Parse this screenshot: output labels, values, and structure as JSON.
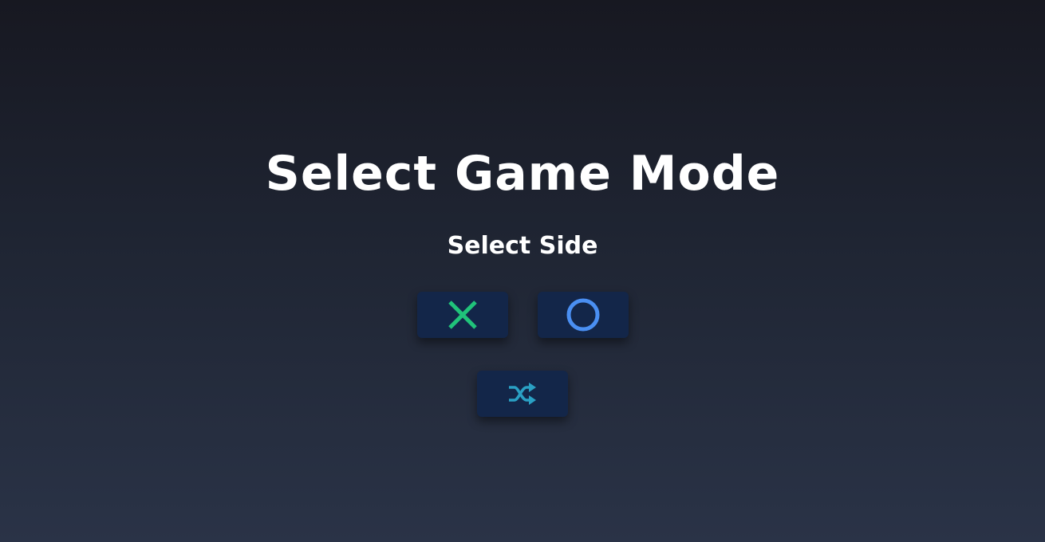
{
  "screen": {
    "title": "Select Game Mode",
    "subtitle": "Select Side"
  },
  "sides": [
    {
      "id": "x",
      "icon": "x-mark-icon",
      "color": "#20c37a"
    },
    {
      "id": "o",
      "icon": "circle-icon",
      "color": "#4a8ff2"
    }
  ],
  "random": {
    "icon": "shuffle-icon",
    "color": "#2aa0c4"
  },
  "colors": {
    "background_top": "#171821",
    "background_bottom": "#2a3347",
    "button_bg": "#132649",
    "text": "#ffffff"
  }
}
